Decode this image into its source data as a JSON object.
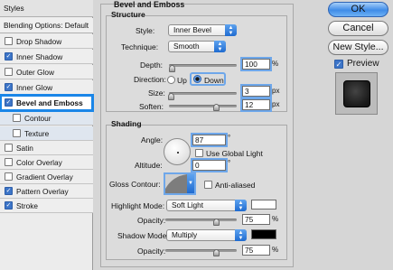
{
  "styles_list": {
    "header": "Styles",
    "blending_options": "Blending Options: Default",
    "items": [
      {
        "label": "Drop Shadow",
        "checked": false
      },
      {
        "label": "Inner Shadow",
        "checked": true
      },
      {
        "label": "Outer Glow",
        "checked": false
      },
      {
        "label": "Inner Glow",
        "checked": true
      },
      {
        "label": "Bevel and Emboss",
        "checked": true,
        "selected": true
      },
      {
        "label": "Contour",
        "checked": false,
        "sub": true
      },
      {
        "label": "Texture",
        "checked": false,
        "sub": true
      },
      {
        "label": "Satin",
        "checked": false
      },
      {
        "label": "Color Overlay",
        "checked": false
      },
      {
        "label": "Gradient Overlay",
        "checked": false
      },
      {
        "label": "Pattern Overlay",
        "checked": true
      },
      {
        "label": "Stroke",
        "checked": true
      }
    ]
  },
  "bevel": {
    "title": "Bevel and Emboss",
    "structure_title": "Structure",
    "style_label": "Style:",
    "style_value": "Inner Bevel",
    "technique_label": "Technique:",
    "technique_value": "Smooth",
    "depth_label": "Depth:",
    "depth_value": "100",
    "depth_unit": "%",
    "direction_label": "Direction:",
    "direction_up": "Up",
    "direction_down": "Down",
    "size_label": "Size:",
    "size_value": "3",
    "size_unit": "px",
    "soften_label": "Soften:",
    "soften_value": "12",
    "soften_unit": "px"
  },
  "shading": {
    "title": "Shading",
    "angle_label": "Angle:",
    "angle_value": "87",
    "angle_unit": "°",
    "use_global_light": "Use Global Light",
    "altitude_label": "Altitude:",
    "altitude_value": "0",
    "altitude_unit": "°",
    "gloss_contour_label": "Gloss Contour:",
    "anti_aliased": "Anti-aliased",
    "highlight_mode_label": "Highlight Mode:",
    "highlight_mode_value": "Soft Light",
    "highlight_color": "#ffffff",
    "highlight_opacity_label": "Opacity:",
    "highlight_opacity_value": "75",
    "highlight_opacity_unit": "%",
    "shadow_mode_label": "Shadow Mode:",
    "shadow_mode_value": "Multiply",
    "shadow_color": "#000000",
    "shadow_opacity_label": "Opacity:",
    "shadow_opacity_value": "75",
    "shadow_opacity_unit": "%"
  },
  "buttons": {
    "ok": "OK",
    "cancel": "Cancel",
    "new_style": "New Style...",
    "preview": "Preview"
  },
  "colors": {
    "accent": "#1a86e8",
    "checkbox_on": "#3d75c8"
  }
}
